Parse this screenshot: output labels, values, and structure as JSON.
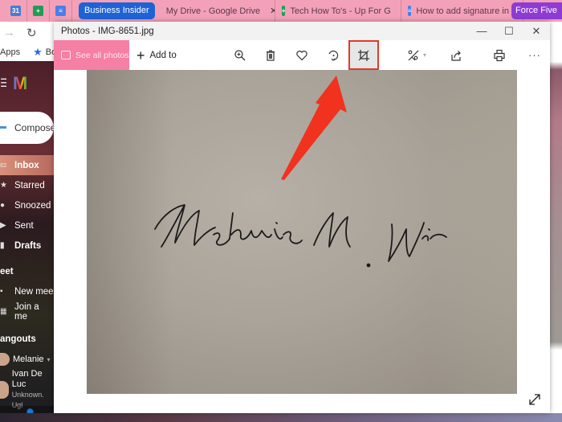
{
  "browser": {
    "tabs": [
      {
        "icon": "calendar-icon",
        "label": ""
      },
      {
        "icon": "sheets-icon",
        "label": ""
      },
      {
        "icon": "docs-icon",
        "label": ""
      },
      {
        "type": "group",
        "label": "Business Insider"
      },
      {
        "icon": "drive-icon",
        "label": "My Drive - Google Drive"
      },
      {
        "icon": "sheets-icon",
        "label": "Tech How To's - Up For G"
      },
      {
        "icon": "docs-icon",
        "label": "How to add signature in"
      },
      {
        "type": "group",
        "label": "Force Five"
      }
    ],
    "bookmarks": {
      "apps": "Apps",
      "bookmark": "Boo"
    }
  },
  "gmail": {
    "logo_letter": "M",
    "compose": "Compose",
    "nav": [
      {
        "label": "Inbox",
        "icon": "inbox-icon",
        "active": true
      },
      {
        "label": "Starred",
        "icon": "star-icon"
      },
      {
        "label": "Snoozed",
        "icon": "clock-icon"
      },
      {
        "label": "Sent",
        "icon": "send-icon"
      },
      {
        "label": "Drafts",
        "icon": "draft-icon",
        "bold": true
      }
    ],
    "meet": {
      "title": "eet",
      "items": [
        {
          "label": "New mee",
          "icon": "video-icon"
        },
        {
          "label": "Join a me",
          "icon": "keyboard-icon"
        }
      ]
    },
    "hangouts": {
      "title": "angouts",
      "user": "Melanie",
      "contacts": [
        {
          "name": "Ivan De Luc",
          "status": "Unknown. Ugl"
        }
      ]
    }
  },
  "photos": {
    "window_title": "Photos - IMG-8651.jpg",
    "see_all": "See all photos",
    "add_to": "Add to",
    "toolbar_icons": [
      "zoom-in-icon",
      "delete-icon",
      "favorite-icon",
      "rotate-icon",
      "crop-icon",
      "edit-icon",
      "share-icon",
      "print-icon",
      "more-icon"
    ],
    "highlighted_tool": "crop-icon",
    "signature_text": "Melanie M. Win",
    "accent": "#f57fa5",
    "highlight_color": "#e0392b"
  }
}
